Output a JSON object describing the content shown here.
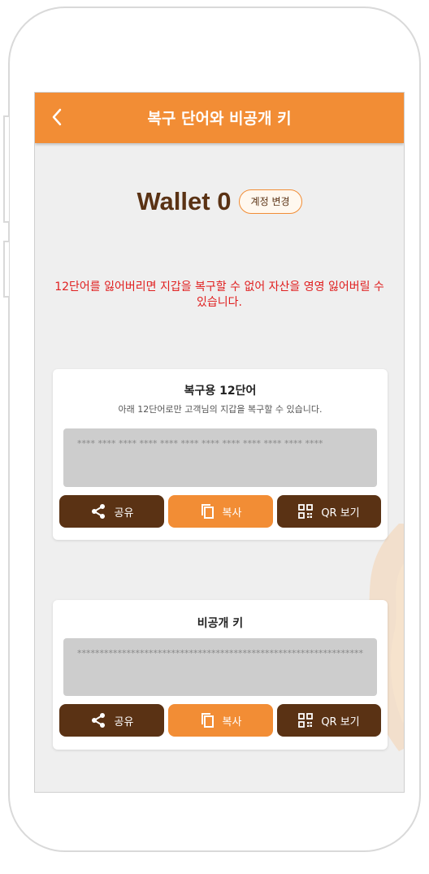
{
  "header": {
    "title": "복구 단어와 비공개 키"
  },
  "wallet": {
    "name": "Wallet 0",
    "change_label": "계정 변경"
  },
  "warning": "12단어를 잃어버리면 지갑을 복구할 수 없어 자산을 영영 잃어버릴 수 있습니다.",
  "recovery": {
    "title": "복구용 12단어",
    "subtitle": "아래 12단어로만 고객님의 지갑을 복구할 수 있습니다.",
    "masked": "**** **** **** **** **** **** **** **** **** **** **** ****",
    "share_label": "공유",
    "copy_label": "복사",
    "qr_label": "QR 보기"
  },
  "private_key": {
    "title": "비공개 키",
    "masked": "****************************************************************",
    "share_label": "공유",
    "copy_label": "복사",
    "qr_label": "QR 보기"
  },
  "colors": {
    "accent": "#f28d35",
    "brown": "#5a3214",
    "warning": "#e02020"
  },
  "icons": [
    "back-arrow-icon",
    "share-icon",
    "copy-icon",
    "qr-code-icon"
  ]
}
